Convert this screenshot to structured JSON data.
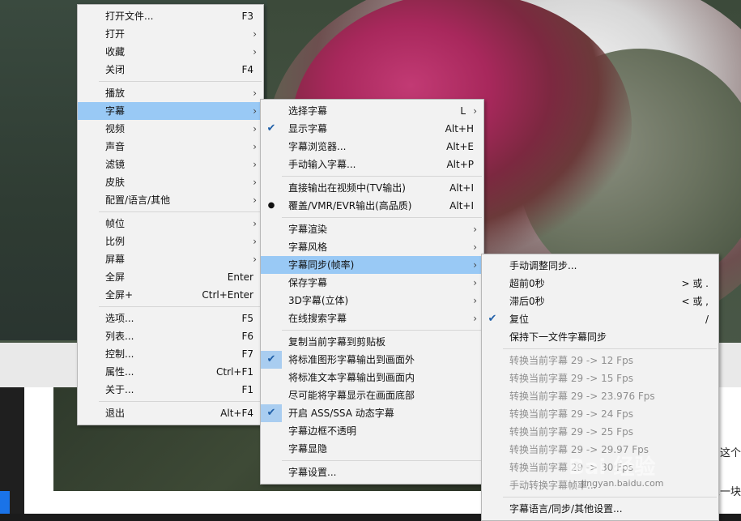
{
  "menu1": [
    {
      "label": "打开文件...",
      "shortcut": "F3"
    },
    {
      "label": "打开",
      "submenu": true
    },
    {
      "label": "收藏",
      "submenu": true
    },
    {
      "label": "关闭",
      "shortcut": "F4"
    },
    {
      "sep": true
    },
    {
      "label": "播放",
      "submenu": true
    },
    {
      "label": "字幕",
      "submenu": true,
      "highlight": true
    },
    {
      "label": "视频",
      "submenu": true
    },
    {
      "label": "声音",
      "submenu": true
    },
    {
      "label": "滤镜",
      "submenu": true
    },
    {
      "label": "皮肤",
      "submenu": true
    },
    {
      "label": "配置/语言/其他",
      "submenu": true
    },
    {
      "sep": true
    },
    {
      "label": "帧位",
      "submenu": true
    },
    {
      "label": "比例",
      "submenu": true
    },
    {
      "label": "屏幕",
      "submenu": true
    },
    {
      "label": "全屏",
      "shortcut": "Enter"
    },
    {
      "label": "全屏+",
      "shortcut": "Ctrl+Enter"
    },
    {
      "sep": true
    },
    {
      "label": "选项...",
      "shortcut": "F5"
    },
    {
      "label": "列表...",
      "shortcut": "F6"
    },
    {
      "label": "控制...",
      "shortcut": "F7"
    },
    {
      "label": "属性...",
      "shortcut": "Ctrl+F1"
    },
    {
      "label": "关于...",
      "shortcut": "F1"
    },
    {
      "sep": true
    },
    {
      "label": "退出",
      "shortcut": "Alt+F4"
    }
  ],
  "menu2": [
    {
      "label": "选择字幕",
      "shortcut": "L",
      "submenu": true
    },
    {
      "label": "显示字幕",
      "shortcut": "Alt+H",
      "check": "check"
    },
    {
      "label": "字幕浏览器...",
      "shortcut": "Alt+E"
    },
    {
      "label": "手动输入字幕...",
      "shortcut": "Alt+P"
    },
    {
      "sep": true
    },
    {
      "label": "直接输出在视频中(TV输出)",
      "shortcut": "Alt+I"
    },
    {
      "label": "覆盖/VMR/EVR输出(高品质)",
      "shortcut": "Alt+I",
      "check": "dot"
    },
    {
      "sep": true
    },
    {
      "label": "字幕渲染",
      "submenu": true
    },
    {
      "label": "字幕风格",
      "submenu": true
    },
    {
      "label": "字幕同步(帧率)",
      "submenu": true,
      "highlight": true
    },
    {
      "label": "保存字幕",
      "submenu": true
    },
    {
      "label": "3D字幕(立体)",
      "submenu": true
    },
    {
      "label": "在线搜索字幕",
      "submenu": true
    },
    {
      "sep": true
    },
    {
      "label": "复制当前字幕到剪贴板"
    },
    {
      "label": "将标准图形字幕输出到画面外",
      "check": "box"
    },
    {
      "label": "将标准文本字幕输出到画面内"
    },
    {
      "label": "尽可能将字幕显示在画面底部"
    },
    {
      "label": "开启 ASS/SSA 动态字幕",
      "check": "box"
    },
    {
      "label": "字幕边框不透明"
    },
    {
      "label": "字幕显隐"
    },
    {
      "sep": true
    },
    {
      "label": "字幕设置..."
    }
  ],
  "menu3": [
    {
      "label": "手动调整同步..."
    },
    {
      "label": "超前0秒",
      "shortcut": "> 或 ."
    },
    {
      "label": "滞后0秒",
      "shortcut": "< 或 ,"
    },
    {
      "label": "复位",
      "shortcut": "/",
      "check": "check"
    },
    {
      "label": "保持下一文件字幕同步"
    },
    {
      "sep": true
    },
    {
      "label": "转换当前字幕 29 -> 12 Fps",
      "disabled": true
    },
    {
      "label": "转换当前字幕 29 -> 15 Fps",
      "disabled": true
    },
    {
      "label": "转换当前字幕 29 -> 23.976 Fps",
      "disabled": true
    },
    {
      "label": "转换当前字幕 29 -> 24 Fps",
      "disabled": true
    },
    {
      "label": "转换当前字幕 29 -> 25 Fps",
      "disabled": true
    },
    {
      "label": "转换当前字幕 29 -> 29.97 Fps",
      "disabled": true
    },
    {
      "label": "转换当前字幕 29 -> 30 Fps",
      "disabled": true
    },
    {
      "label": "手动转换字幕帧率...",
      "disabled": true
    },
    {
      "sep": true
    },
    {
      "label": "字幕语言/同步/其他设置..."
    }
  ],
  "side_texts": [
    "这个",
    "家一块"
  ],
  "watermark": "Bai 经验",
  "watermark_url": "jingyan.baidu.com"
}
